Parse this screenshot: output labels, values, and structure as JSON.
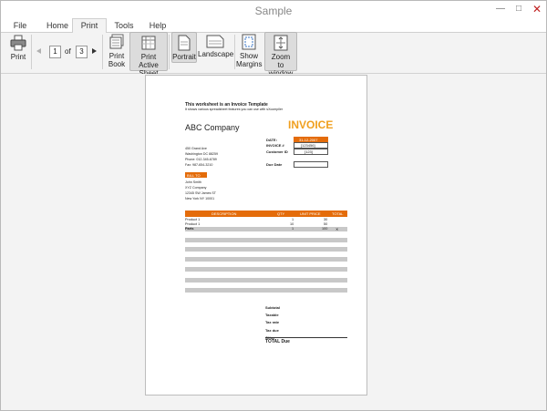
{
  "window": {
    "title": "Sample",
    "controls": {
      "minimize": "—",
      "maximize": "□",
      "close": "✕"
    }
  },
  "menu": {
    "items": [
      "File",
      "Home",
      "Print",
      "Tools",
      "Help"
    ],
    "active_index": 2
  },
  "ribbon": {
    "print_label": "Print",
    "page_current": "1",
    "page_of_label": "of",
    "page_total": "3",
    "print_book_label": [
      "Print",
      "Book"
    ],
    "print_active_sheet_label": [
      "Print",
      "Active Sheet"
    ],
    "portrait_label": "Portrait",
    "landscape_label": "Landscape",
    "show_margins_label": [
      "Show",
      "Margins"
    ],
    "zoom_label": [
      "Zoom",
      "to window"
    ]
  },
  "preview": {
    "heading": "This worksheet is an Invoice Template",
    "subheading": "It shows various spreadsheet features you can use with sXcompiler",
    "company": "ABC Company",
    "invoice_title": "INVOICE",
    "address": [
      "450 Grand Ave",
      "Washington DC 88259",
      "Phone: 012-345-6789",
      "Fax: 987-654-3210"
    ],
    "date_label": "DATE:",
    "date_value": "31-12-2007",
    "invoice_no_label": "INVOICE #",
    "invoice_no_value": "[123456]",
    "customer_id_label": "Customer ID",
    "customer_id_value": "[123]",
    "due_date_label": "Due Date",
    "bill_to_label": "BILL TO",
    "bill_to": [
      "John Smith",
      "XYZ Company",
      "12345 SW James ST",
      "New York NY 10001"
    ],
    "table_headers": [
      "DESCRIPTION",
      "QTY",
      "UNIT PRICE",
      "TOTAL"
    ],
    "rows": [
      {
        "desc": "Product 1",
        "qty": "1",
        "price": "30",
        "total": ""
      },
      {
        "desc": "Product 1",
        "qty": "10",
        "price": "50",
        "total": ""
      },
      {
        "desc": "Parts",
        "qty": "1",
        "price": "100",
        "total": "✕"
      }
    ],
    "summary": [
      "Subtotal",
      "Taxable",
      "Tax rate",
      "Tax due",
      "Other"
    ],
    "total_due_label": "TOTAL Due"
  },
  "colors": {
    "accent": "#e46c0a",
    "row_gray": "#c8c8c8",
    "selected_button": "#dcdcdc"
  }
}
